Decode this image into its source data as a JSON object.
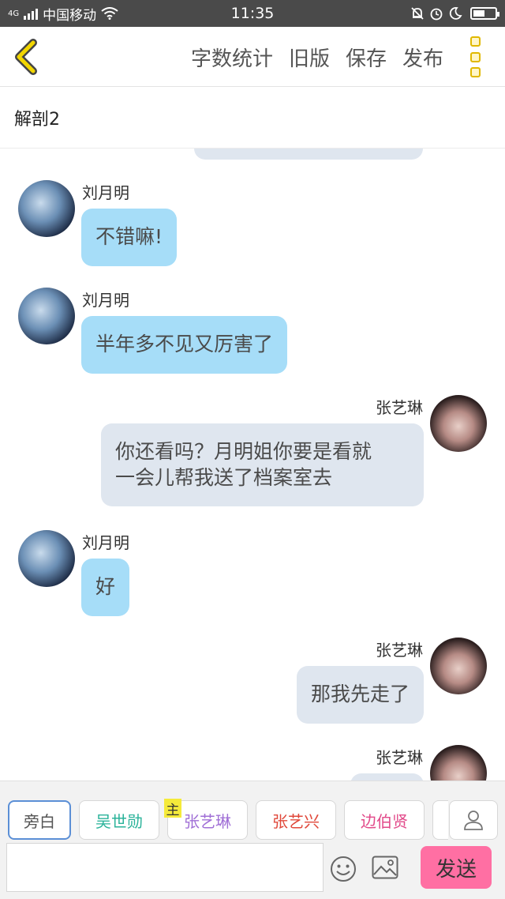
{
  "status_bar": {
    "network": "4G",
    "carrier": "中国移动",
    "time": "11:35"
  },
  "header": {
    "actions": [
      "字数统计",
      "旧版",
      "保存",
      "发布"
    ]
  },
  "chapter": {
    "title": "解剖2"
  },
  "messages": [
    {
      "side": "left",
      "name": "刘月明",
      "text": "不错嘛!"
    },
    {
      "side": "left",
      "name": "刘月明",
      "text": "半年多不见又厉害了"
    },
    {
      "side": "right",
      "name": "张艺琳",
      "line1": "你还看吗？月明姐你要是看就",
      "line2": "一会儿帮我送了档案室去"
    },
    {
      "side": "left",
      "name": "刘月明",
      "text": "好"
    },
    {
      "side": "right",
      "name": "张艺琳",
      "text": "那我先走了"
    },
    {
      "side": "right",
      "name": "张艺琳",
      "text": ""
    }
  ],
  "characters": {
    "main_tag": "主",
    "tabs": [
      {
        "label": "旁白",
        "color": "#555555"
      },
      {
        "label": "吴世勋",
        "color": "#2bb39a"
      },
      {
        "label": "张艺琳",
        "color": "#a06fd6"
      },
      {
        "label": "张艺兴",
        "color": "#e0483a"
      },
      {
        "label": "边伯贤",
        "color": "#e24a8a"
      }
    ]
  },
  "composer": {
    "input_value": "",
    "send_label": "发送"
  },
  "icons": {
    "back": "chevron-left-icon",
    "more": "more-vertical-icon",
    "profile": "person-icon",
    "emoji": "smiley-icon",
    "image": "image-icon"
  },
  "colors": {
    "accent_yellow": "#e0b800",
    "bubble_left": "#a6ddf8",
    "bubble_right": "#dfe6ef",
    "send": "#ff6fa3"
  }
}
